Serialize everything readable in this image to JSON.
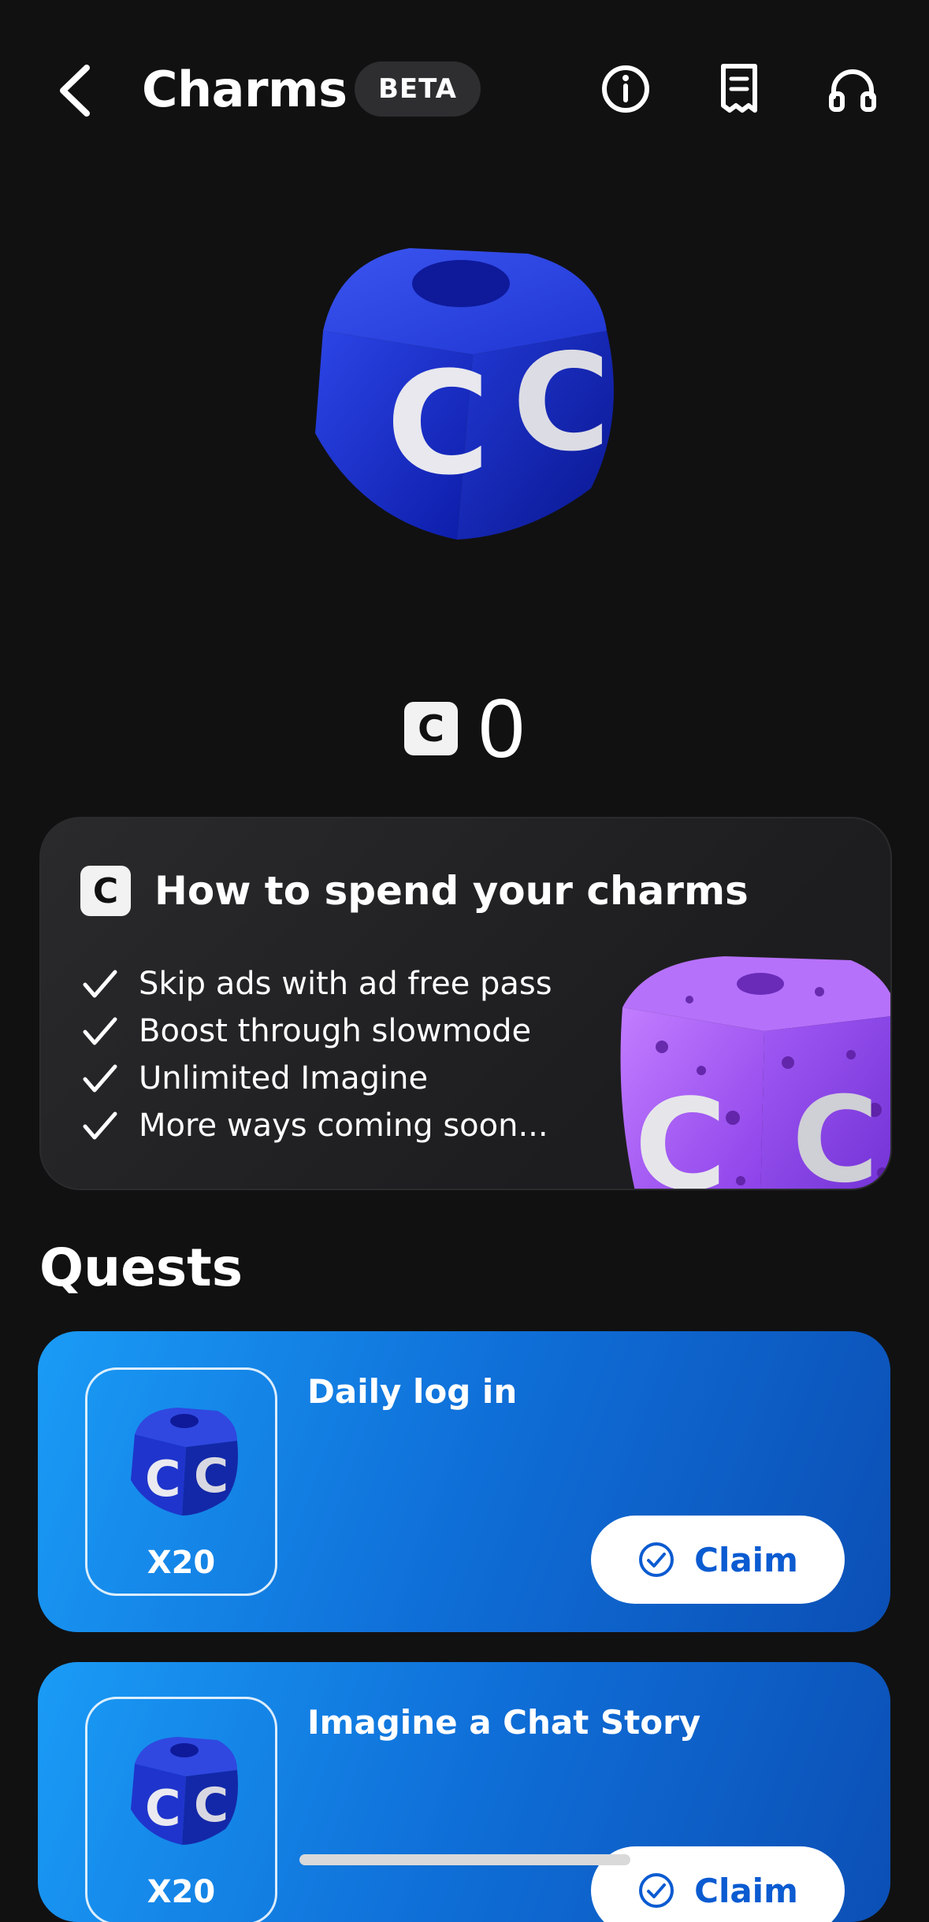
{
  "header": {
    "title": "Charms",
    "badge": "BETA",
    "icons": [
      "back-arrow-icon",
      "info-icon",
      "receipt-icon",
      "headphones-icon"
    ]
  },
  "balance": {
    "currency_glyph": "C",
    "amount": "0"
  },
  "spend_card": {
    "badge_glyph": "C",
    "title": "How to spend your charms",
    "benefits": [
      "Skip ads with ad free pass",
      "Boost through slowmode",
      "Unlimited Imagine",
      "More ways coming soon..."
    ]
  },
  "quests": {
    "title": "Quests",
    "items": [
      {
        "name": "Daily log in",
        "reward": "X20",
        "claim_label": "Claim"
      },
      {
        "name": "Imagine a Chat Story",
        "reward": "X20",
        "claim_label": "Claim"
      }
    ]
  },
  "colors": {
    "background": "#111112",
    "quest_gradient_start": "#1a9bf6",
    "quest_gradient_end": "#0b4fb5",
    "claim_text": "#0b5bd1"
  }
}
